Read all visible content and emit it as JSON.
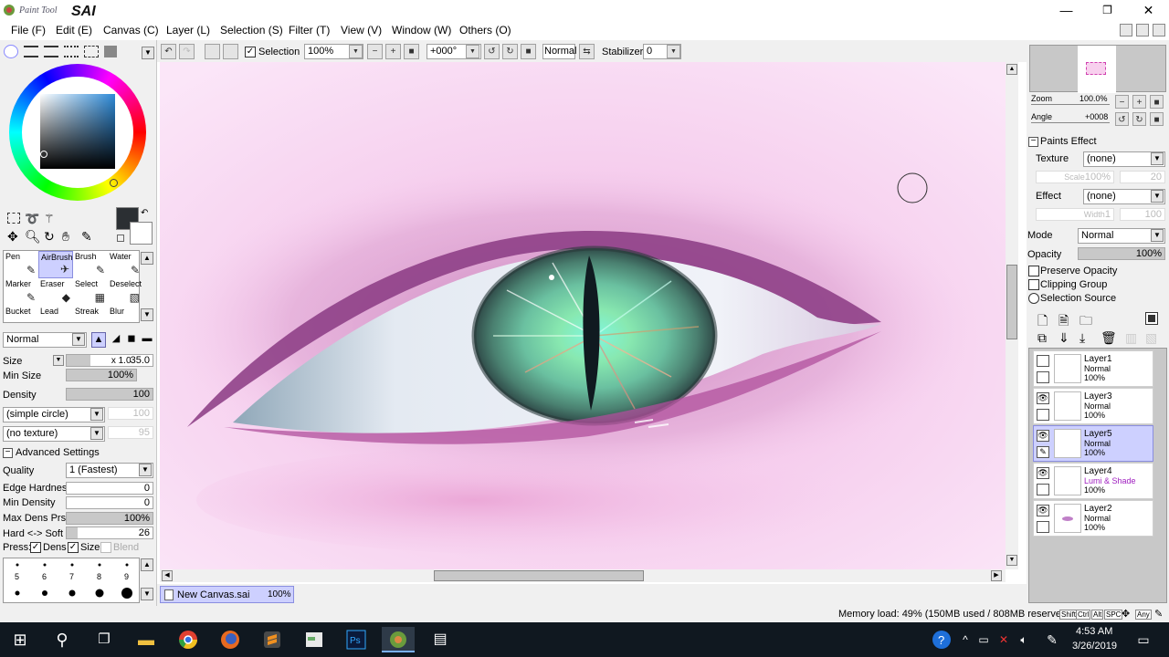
{
  "app": {
    "name": "PaintTool SAI",
    "logo_small": "Paint Tool",
    "logo_big": "SAI"
  },
  "window_buttons": [
    "—",
    "❐",
    "✕"
  ],
  "menu": [
    "File (F)",
    "Edit (E)",
    "Canvas (C)",
    "Layer (L)",
    "Selection (S)",
    "Filter (T)",
    "View (V)",
    "Window (W)",
    "Others (O)"
  ],
  "toolbar": {
    "selection_label": "Selection",
    "selection_checked": true,
    "zoom": "100%",
    "angle": "+000°",
    "blend": "Normal",
    "stabilizer_label": "Stabilizer",
    "stabilizer_value": "0"
  },
  "color": {
    "primary": "#2b2f33",
    "secondary": "#ffffff"
  },
  "tools": [
    {
      "name": "Pen",
      "icon": "pen-icon"
    },
    {
      "name": "AirBrush",
      "icon": "airbrush-icon",
      "selected": true
    },
    {
      "name": "Brush",
      "icon": "brush-icon"
    },
    {
      "name": "Water",
      "icon": "water-icon"
    },
    {
      "name": "Marker",
      "icon": "marker-icon"
    },
    {
      "name": "Eraser",
      "icon": "eraser-icon"
    },
    {
      "name": "Select",
      "icon": "select-icon"
    },
    {
      "name": "Deselect",
      "icon": "deselect-icon"
    },
    {
      "name": "Bucket",
      "icon": "bucket-icon"
    },
    {
      "name": "Lead",
      "icon": "lead-icon"
    },
    {
      "name": "Streak",
      "icon": "streak-icon"
    },
    {
      "name": "Blur",
      "icon": "blur-icon"
    }
  ],
  "brush": {
    "mode": "Normal",
    "size_label": "Size",
    "size_mult": "x 1.0",
    "size_value": "35.0",
    "min_size_label": "Min Size",
    "min_size_value": "100%",
    "density_label": "Density",
    "density_value": "100",
    "shape": "(simple circle)",
    "shape_value": "100",
    "texture": "(no texture)",
    "texture_value": "95",
    "advanced_label": "Advanced Settings",
    "quality_label": "Quality",
    "quality_value": "1 (Fastest)",
    "edge_label": "Edge Hardness",
    "edge_value": "0",
    "min_density_label": "Min Density",
    "min_density_value": "0",
    "max_dens_label": "Max Dens Prs.",
    "max_dens_value": "100%",
    "hardsoft_label": "Hard <-> Soft",
    "hardsoft_value": "26",
    "press_label": "Press:",
    "press_dens": "Dens",
    "press_size": "Size",
    "press_blend": "Blend"
  },
  "brush_sizes": [
    "",
    "",
    "",
    "",
    "",
    "5",
    "6",
    "7",
    "8",
    "9",
    "",
    "",
    "",
    "",
    ""
  ],
  "navigator": {
    "zoom_label": "Zoom",
    "zoom_value": "100.0%",
    "angle_label": "Angle",
    "angle_value": "+0008"
  },
  "paints_effect": {
    "title": "Paints Effect",
    "texture_label": "Texture",
    "texture_value": "(none)",
    "scale_label": "Scale",
    "scale_value": "100%",
    "scale_num": "20",
    "effect_label": "Effect",
    "effect_value": "(none)",
    "width_label": "Width",
    "width_value": "1",
    "width_num": "100"
  },
  "layer_props": {
    "mode_label": "Mode",
    "mode_value": "Normal",
    "opacity_label": "Opacity",
    "opacity_value": "100%",
    "preserve_opacity": "Preserve Opacity",
    "clipping_group": "Clipping Group",
    "selection_source": "Selection Source"
  },
  "layers": [
    {
      "name": "Layer1",
      "mode": "Normal",
      "opacity": "100%",
      "visible": false,
      "selected": false,
      "special": false
    },
    {
      "name": "Layer3",
      "mode": "Normal",
      "opacity": "100%",
      "visible": true,
      "selected": false,
      "special": false
    },
    {
      "name": "Layer5",
      "mode": "Normal",
      "opacity": "100%",
      "visible": true,
      "selected": true,
      "special": false
    },
    {
      "name": "Layer4",
      "mode": "Lumi & Shade",
      "opacity": "100%",
      "visible": true,
      "selected": false,
      "special": true
    },
    {
      "name": "Layer2",
      "mode": "Normal",
      "opacity": "100%",
      "visible": true,
      "selected": false,
      "special": false
    }
  ],
  "doc_tab": {
    "name": "New Canvas.sai",
    "zoom": "100%"
  },
  "status": {
    "memory": "Memory load: 49% (150MB used / 808MB reserved)",
    "keys": [
      "Shift",
      "Ctrl",
      "Alt",
      "SPC",
      "Any"
    ]
  },
  "taskbar": {
    "time": "4:53 AM",
    "date": "3/26/2019"
  }
}
